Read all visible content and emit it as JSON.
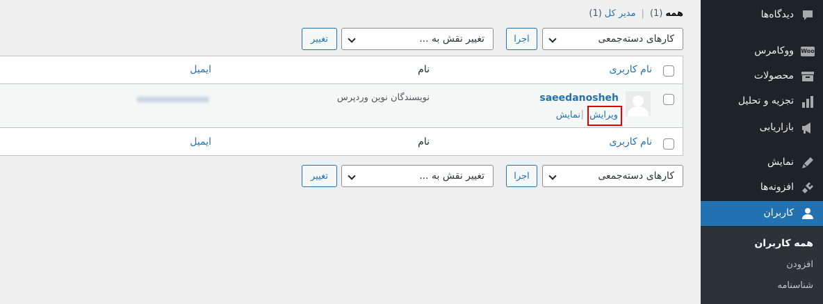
{
  "sidebar": {
    "items": [
      {
        "label": "دیدگاه‌ها",
        "icon": "comment-icon"
      },
      {
        "label": "ووکامرس",
        "icon": "woo-icon",
        "icon_text": "Woo"
      },
      {
        "label": "محصولات",
        "icon": "archive-icon"
      },
      {
        "label": "تجزیه و تحلیل",
        "icon": "bar-chart-icon"
      },
      {
        "label": "بازاریابی",
        "icon": "megaphone-icon"
      },
      {
        "label": "نمایش",
        "icon": "brush-icon"
      },
      {
        "label": "افزونه‌ها",
        "icon": "plugin-icon"
      },
      {
        "label": "کاربران",
        "icon": "user-icon"
      }
    ],
    "submenu": [
      "همه کاربران",
      "افزودن",
      "شناسنامه"
    ],
    "accent_color": "#2271b1"
  },
  "views": {
    "all_label": "همه",
    "all_count": "(1)",
    "admin_label": "مدیر کل",
    "admin_count": "(1)"
  },
  "toolbar": {
    "bulk_actions": "کارهای دسته‌جمعی",
    "apply": "اجرا",
    "change_role": "تغییر نقش به ...",
    "change": "تغییر"
  },
  "table": {
    "columns": {
      "username": "نام کاربری",
      "name": "نام",
      "email": "ایمیل"
    },
    "row": {
      "username": "saeedanosheh",
      "name": "نویسندگان نوین وردپرس",
      "actions": {
        "edit": "ویرایش",
        "view": "نمایش"
      }
    }
  }
}
